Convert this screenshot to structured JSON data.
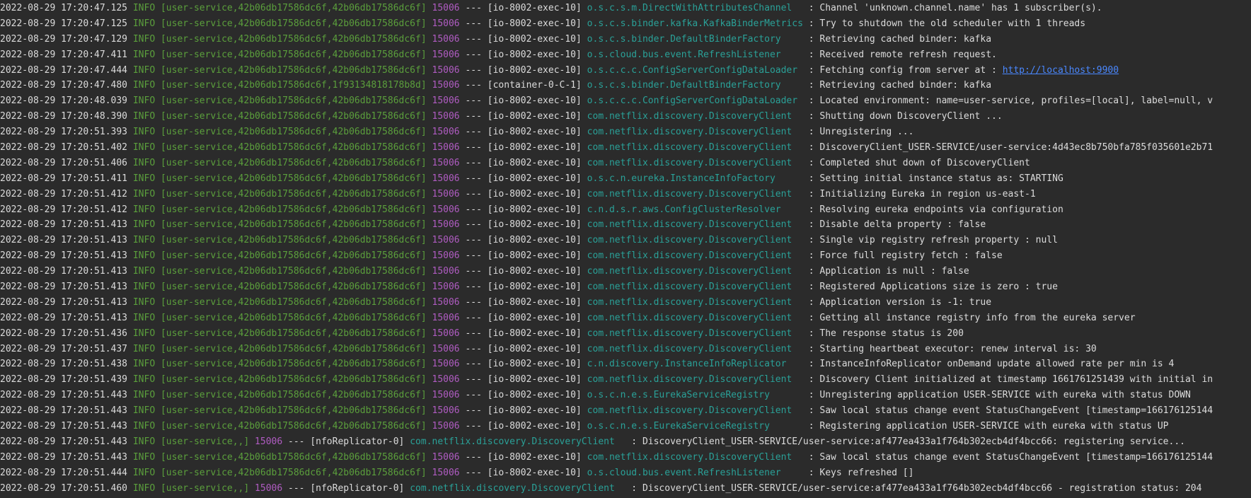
{
  "console": {
    "colors": {
      "background": "#2b2b2b",
      "text": "#dcdcdc",
      "level": "#5b9f3c",
      "context": "#5b9f3c",
      "pid": "#b05cc2",
      "logger": "#2aa198",
      "link": "#4a88ff"
    },
    "lines": [
      {
        "ts": "2022-08-29 17:20:47.125",
        "level": "INFO",
        "ctx": "[user-service,42b06db17586dc6f,42b06db17586dc6f]",
        "pid": "15006",
        "sep": "---",
        "thread": "[io-8002-exec-10]",
        "logger": "o.s.c.s.m.DirectWithAttributesChannel",
        "msg": "Channel 'unknown.channel.name' has 1 subscriber(s)."
      },
      {
        "ts": "2022-08-29 17:20:47.125",
        "level": "INFO",
        "ctx": "[user-service,42b06db17586dc6f,42b06db17586dc6f]",
        "pid": "15006",
        "sep": "---",
        "thread": "[io-8002-exec-10]",
        "logger": "o.s.c.s.binder.kafka.KafkaBinderMetrics",
        "msg": "Try to shutdown the old scheduler with 1 threads"
      },
      {
        "ts": "2022-08-29 17:20:47.129",
        "level": "INFO",
        "ctx": "[user-service,42b06db17586dc6f,42b06db17586dc6f]",
        "pid": "15006",
        "sep": "---",
        "thread": "[io-8002-exec-10]",
        "logger": "o.s.c.s.binder.DefaultBinderFactory",
        "msg": "Retrieving cached binder: kafka"
      },
      {
        "ts": "2022-08-29 17:20:47.411",
        "level": "INFO",
        "ctx": "[user-service,42b06db17586dc6f,42b06db17586dc6f]",
        "pid": "15006",
        "sep": "---",
        "thread": "[io-8002-exec-10]",
        "logger": "o.s.cloud.bus.event.RefreshListener",
        "msg": "Received remote refresh request."
      },
      {
        "ts": "2022-08-29 17:20:47.444",
        "level": "INFO",
        "ctx": "[user-service,42b06db17586dc6f,42b06db17586dc6f]",
        "pid": "15006",
        "sep": "---",
        "thread": "[io-8002-exec-10]",
        "logger": "o.s.c.c.c.ConfigServerConfigDataLoader",
        "msg": "Fetching config from server at : ",
        "link": "http://localhost:9900"
      },
      {
        "ts": "2022-08-29 17:20:47.480",
        "level": "INFO",
        "ctx": "[user-service,42b06db17586dc6f,1f93134818178b8d]",
        "pid": "15006",
        "sep": "---",
        "thread": "[container-0-C-1]",
        "logger": "o.s.c.s.binder.DefaultBinderFactory",
        "msg": "Retrieving cached binder: kafka"
      },
      {
        "ts": "2022-08-29 17:20:48.039",
        "level": "INFO",
        "ctx": "[user-service,42b06db17586dc6f,42b06db17586dc6f]",
        "pid": "15006",
        "sep": "---",
        "thread": "[io-8002-exec-10]",
        "logger": "o.s.c.c.c.ConfigServerConfigDataLoader",
        "msg": "Located environment: name=user-service, profiles=[local], label=null, v"
      },
      {
        "ts": "2022-08-29 17:20:48.390",
        "level": "INFO",
        "ctx": "[user-service,42b06db17586dc6f,42b06db17586dc6f]",
        "pid": "15006",
        "sep": "---",
        "thread": "[io-8002-exec-10]",
        "logger": "com.netflix.discovery.DiscoveryClient",
        "msg": "Shutting down DiscoveryClient ..."
      },
      {
        "ts": "2022-08-29 17:20:51.393",
        "level": "INFO",
        "ctx": "[user-service,42b06db17586dc6f,42b06db17586dc6f]",
        "pid": "15006",
        "sep": "---",
        "thread": "[io-8002-exec-10]",
        "logger": "com.netflix.discovery.DiscoveryClient",
        "msg": "Unregistering ..."
      },
      {
        "ts": "2022-08-29 17:20:51.402",
        "level": "INFO",
        "ctx": "[user-service,42b06db17586dc6f,42b06db17586dc6f]",
        "pid": "15006",
        "sep": "---",
        "thread": "[io-8002-exec-10]",
        "logger": "com.netflix.discovery.DiscoveryClient",
        "msg": "DiscoveryClient_USER-SERVICE/user-service:4d43ec8b750bfa785f035601e2b71"
      },
      {
        "ts": "2022-08-29 17:20:51.406",
        "level": "INFO",
        "ctx": "[user-service,42b06db17586dc6f,42b06db17586dc6f]",
        "pid": "15006",
        "sep": "---",
        "thread": "[io-8002-exec-10]",
        "logger": "com.netflix.discovery.DiscoveryClient",
        "msg": "Completed shut down of DiscoveryClient"
      },
      {
        "ts": "2022-08-29 17:20:51.411",
        "level": "INFO",
        "ctx": "[user-service,42b06db17586dc6f,42b06db17586dc6f]",
        "pid": "15006",
        "sep": "---",
        "thread": "[io-8002-exec-10]",
        "logger": "o.s.c.n.eureka.InstanceInfoFactory",
        "msg": "Setting initial instance status as: STARTING"
      },
      {
        "ts": "2022-08-29 17:20:51.412",
        "level": "INFO",
        "ctx": "[user-service,42b06db17586dc6f,42b06db17586dc6f]",
        "pid": "15006",
        "sep": "---",
        "thread": "[io-8002-exec-10]",
        "logger": "com.netflix.discovery.DiscoveryClient",
        "msg": "Initializing Eureka in region us-east-1"
      },
      {
        "ts": "2022-08-29 17:20:51.412",
        "level": "INFO",
        "ctx": "[user-service,42b06db17586dc6f,42b06db17586dc6f]",
        "pid": "15006",
        "sep": "---",
        "thread": "[io-8002-exec-10]",
        "logger": "c.n.d.s.r.aws.ConfigClusterResolver",
        "msg": "Resolving eureka endpoints via configuration"
      },
      {
        "ts": "2022-08-29 17:20:51.413",
        "level": "INFO",
        "ctx": "[user-service,42b06db17586dc6f,42b06db17586dc6f]",
        "pid": "15006",
        "sep": "---",
        "thread": "[io-8002-exec-10]",
        "logger": "com.netflix.discovery.DiscoveryClient",
        "msg": "Disable delta property : false"
      },
      {
        "ts": "2022-08-29 17:20:51.413",
        "level": "INFO",
        "ctx": "[user-service,42b06db17586dc6f,42b06db17586dc6f]",
        "pid": "15006",
        "sep": "---",
        "thread": "[io-8002-exec-10]",
        "logger": "com.netflix.discovery.DiscoveryClient",
        "msg": "Single vip registry refresh property : null"
      },
      {
        "ts": "2022-08-29 17:20:51.413",
        "level": "INFO",
        "ctx": "[user-service,42b06db17586dc6f,42b06db17586dc6f]",
        "pid": "15006",
        "sep": "---",
        "thread": "[io-8002-exec-10]",
        "logger": "com.netflix.discovery.DiscoveryClient",
        "msg": "Force full registry fetch : false"
      },
      {
        "ts": "2022-08-29 17:20:51.413",
        "level": "INFO",
        "ctx": "[user-service,42b06db17586dc6f,42b06db17586dc6f]",
        "pid": "15006",
        "sep": "---",
        "thread": "[io-8002-exec-10]",
        "logger": "com.netflix.discovery.DiscoveryClient",
        "msg": "Application is null : false"
      },
      {
        "ts": "2022-08-29 17:20:51.413",
        "level": "INFO",
        "ctx": "[user-service,42b06db17586dc6f,42b06db17586dc6f]",
        "pid": "15006",
        "sep": "---",
        "thread": "[io-8002-exec-10]",
        "logger": "com.netflix.discovery.DiscoveryClient",
        "msg": "Registered Applications size is zero : true"
      },
      {
        "ts": "2022-08-29 17:20:51.413",
        "level": "INFO",
        "ctx": "[user-service,42b06db17586dc6f,42b06db17586dc6f]",
        "pid": "15006",
        "sep": "---",
        "thread": "[io-8002-exec-10]",
        "logger": "com.netflix.discovery.DiscoveryClient",
        "msg": "Application version is -1: true"
      },
      {
        "ts": "2022-08-29 17:20:51.413",
        "level": "INFO",
        "ctx": "[user-service,42b06db17586dc6f,42b06db17586dc6f]",
        "pid": "15006",
        "sep": "---",
        "thread": "[io-8002-exec-10]",
        "logger": "com.netflix.discovery.DiscoveryClient",
        "msg": "Getting all instance registry info from the eureka server"
      },
      {
        "ts": "2022-08-29 17:20:51.436",
        "level": "INFO",
        "ctx": "[user-service,42b06db17586dc6f,42b06db17586dc6f]",
        "pid": "15006",
        "sep": "---",
        "thread": "[io-8002-exec-10]",
        "logger": "com.netflix.discovery.DiscoveryClient",
        "msg": "The response status is 200"
      },
      {
        "ts": "2022-08-29 17:20:51.437",
        "level": "INFO",
        "ctx": "[user-service,42b06db17586dc6f,42b06db17586dc6f]",
        "pid": "15006",
        "sep": "---",
        "thread": "[io-8002-exec-10]",
        "logger": "com.netflix.discovery.DiscoveryClient",
        "msg": "Starting heartbeat executor: renew interval is: 30"
      },
      {
        "ts": "2022-08-29 17:20:51.438",
        "level": "INFO",
        "ctx": "[user-service,42b06db17586dc6f,42b06db17586dc6f]",
        "pid": "15006",
        "sep": "---",
        "thread": "[io-8002-exec-10]",
        "logger": "c.n.discovery.InstanceInfoReplicator",
        "msg": "InstanceInfoReplicator onDemand update allowed rate per min is 4"
      },
      {
        "ts": "2022-08-29 17:20:51.439",
        "level": "INFO",
        "ctx": "[user-service,42b06db17586dc6f,42b06db17586dc6f]",
        "pid": "15006",
        "sep": "---",
        "thread": "[io-8002-exec-10]",
        "logger": "com.netflix.discovery.DiscoveryClient",
        "msg": "Discovery Client initialized at timestamp 1661761251439 with initial in"
      },
      {
        "ts": "2022-08-29 17:20:51.443",
        "level": "INFO",
        "ctx": "[user-service,42b06db17586dc6f,42b06db17586dc6f]",
        "pid": "15006",
        "sep": "---",
        "thread": "[io-8002-exec-10]",
        "logger": "o.s.c.n.e.s.EurekaServiceRegistry",
        "msg": "Unregistering application USER-SERVICE with eureka with status DOWN"
      },
      {
        "ts": "2022-08-29 17:20:51.443",
        "level": "INFO",
        "ctx": "[user-service,42b06db17586dc6f,42b06db17586dc6f]",
        "pid": "15006",
        "sep": "---",
        "thread": "[io-8002-exec-10]",
        "logger": "com.netflix.discovery.DiscoveryClient",
        "msg": "Saw local status change event StatusChangeEvent [timestamp=166176125144"
      },
      {
        "ts": "2022-08-29 17:20:51.443",
        "level": "INFO",
        "ctx": "[user-service,42b06db17586dc6f,42b06db17586dc6f]",
        "pid": "15006",
        "sep": "---",
        "thread": "[io-8002-exec-10]",
        "logger": "o.s.c.n.e.s.EurekaServiceRegistry",
        "msg": "Registering application USER-SERVICE with eureka with status UP"
      },
      {
        "ts": "2022-08-29 17:20:51.443",
        "level": "INFO",
        "ctx": "[user-service,,]",
        "pid": "15006",
        "sep": "---",
        "thread": "[nfoReplicator-0]",
        "logger": "com.netflix.discovery.DiscoveryClient",
        "msg": "DiscoveryClient_USER-SERVICE/user-service:af477ea433a1f764b302ecb4df4bcc66: registering service..."
      },
      {
        "ts": "2022-08-29 17:20:51.443",
        "level": "INFO",
        "ctx": "[user-service,42b06db17586dc6f,42b06db17586dc6f]",
        "pid": "15006",
        "sep": "---",
        "thread": "[io-8002-exec-10]",
        "logger": "com.netflix.discovery.DiscoveryClient",
        "msg": "Saw local status change event StatusChangeEvent [timestamp=166176125144"
      },
      {
        "ts": "2022-08-29 17:20:51.444",
        "level": "INFO",
        "ctx": "[user-service,42b06db17586dc6f,42b06db17586dc6f]",
        "pid": "15006",
        "sep": "---",
        "thread": "[io-8002-exec-10]",
        "logger": "o.s.cloud.bus.event.RefreshListener",
        "msg": "Keys refreshed []"
      },
      {
        "ts": "2022-08-29 17:20:51.460",
        "level": "INFO",
        "ctx": "[user-service,,]",
        "pid": "15006",
        "sep": "---",
        "thread": "[nfoReplicator-0]",
        "logger": "com.netflix.discovery.DiscoveryClient",
        "msg": "DiscoveryClient_USER-SERVICE/user-service:af477ea433a1f764b302ecb4df4bcc66 - registration status: 204"
      }
    ]
  }
}
